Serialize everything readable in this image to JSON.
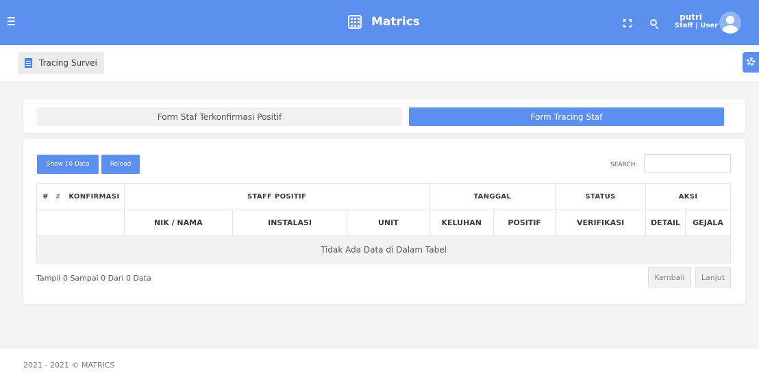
{
  "header": {
    "app_title": "Matrics",
    "user_name": "putri",
    "user_role": "Staff | User",
    "accent_color": "#5b8ff0",
    "icons": [
      "menu-icon",
      "grid-icon",
      "fullscreen-icon",
      "search-icon",
      "avatar-icon"
    ]
  },
  "breadcrumb": {
    "label": "Tracing Survei",
    "icon": "document-icon"
  },
  "settings": {
    "icon": "gear-icon"
  },
  "tabs": [
    {
      "label": "Form Staf Terkonfirmasi Positif",
      "active": false
    },
    {
      "label": "Form Tracing Staf",
      "active": true
    }
  ],
  "table_controls": {
    "show_label": "Show 10 Data",
    "reload_label": "Reload",
    "search_label": "SEARCH:",
    "search_value": ""
  },
  "table": {
    "group_headers": {
      "hash": "#",
      "konfirmasi": "KONFIRMASI",
      "staff_positif": "STAFF POSITIF",
      "tanggal": "TANGGAL",
      "status": "STATUS",
      "aksi": "AKSI"
    },
    "sub_headers": [
      "NIK / NAMA",
      "INSTALASI",
      "UNIT",
      "KELUHAN",
      "POSITIF",
      "VERIFIKASI",
      "DETAIL",
      "GEJALA"
    ],
    "rows": [],
    "empty_message": "Tidak Ada Data di Dalam Tabel"
  },
  "pagination": {
    "info": "Tampil 0 Sampai 0 Dari 0 Data",
    "prev_label": "Kembali",
    "next_label": "Lanjut"
  },
  "footer": {
    "text": "2021 - 2021 © MATRICS"
  }
}
